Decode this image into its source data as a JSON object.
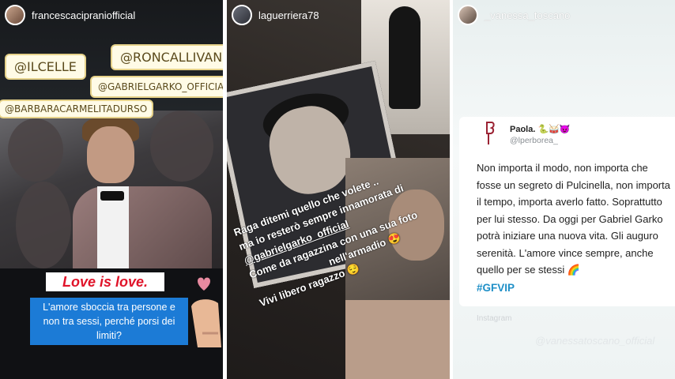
{
  "panel1": {
    "username": "francescacipraniofficial",
    "tags": [
      "@ILCELLE",
      "@RONCALLIVAN",
      "@GABRIELGARKO_OFFICIAL",
      "@BARBARACARMELITADURSO"
    ],
    "banner_title": "Love is love.",
    "banner_text": "L'amore sboccia tra persone e non tra sessi, perché porsi dei limiti?"
  },
  "panel2": {
    "username": "laguerriera78",
    "lines": [
      "Raga ditemi quello che volete ..",
      "ma io resterò sempre innamorata di",
      "@gabrielgarko_official",
      "Come da ragazzina con una sua foto",
      "nell'armadio 😍",
      "Vivi libero ragazzo 😌"
    ]
  },
  "panel3": {
    "username": "_vanessa_toscano",
    "tweet": {
      "name": "Paola. 🐍🥁😈",
      "handle": "@lperborea_",
      "body": "Non importa il modo, non importa che fosse un segreto di Pulcinella, non importa il tempo, importa averlo fatto. Soprattutto per lui stesso. Da oggi per Gabriel Garko potrà iniziare una nuova vita. Gli auguro serenità. L'amore vince sempre, anche quello per se stessi 🌈",
      "hashtag": "#GFVIP",
      "footer": "Instagram",
      "watermark": "@vanessatoscano_official"
    }
  }
}
